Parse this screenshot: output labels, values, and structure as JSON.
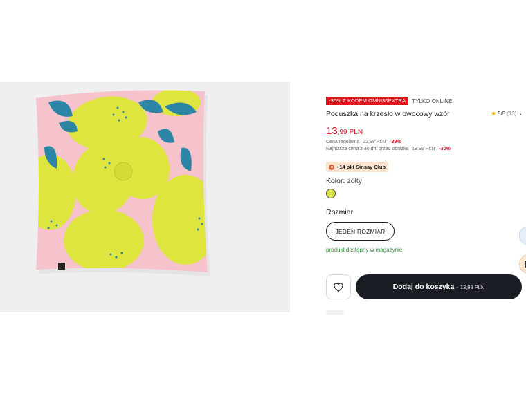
{
  "product": {
    "promo_badge": "-30% Z KODEM OMNI30EXTRA",
    "online_badge": "TYLKO ONLINE",
    "title": "Poduszka na krzesło w owocowy wzór",
    "rating": {
      "score": "5/5",
      "count": "(13)"
    },
    "price": {
      "int": "13",
      "dec": ",99",
      "currency": "PLN",
      "regular_label": "Cena regularna",
      "regular_value": "22,99 PLN",
      "regular_discount": "-39%",
      "lowest_label": "Najniższa cena z 30 dni przed obniżką",
      "lowest_value": "19,99 PLN",
      "lowest_discount": "-30%"
    },
    "club": {
      "points": "+14 pkt",
      "name": "Sinsay Club"
    },
    "color": {
      "label": "Kolor:",
      "value": "żółty",
      "swatch_hex": "#dbe24d"
    },
    "size": {
      "label": "Rozmiar",
      "option": "JEDEN ROZMIAR"
    },
    "availability": "produkt dostępny w magazynie",
    "cart": {
      "label": "Dodaj do koszyka",
      "separator": "-",
      "amount": "13,99 PLN"
    }
  },
  "colors": {
    "pillow_pink": "#f6c3cd",
    "lemon_yellow": "#dee53f",
    "leaf_blue": "#2e86a6",
    "price_red": "#d4182a",
    "cart_button": "#1b1d24",
    "availability_green": "#2f8f3a"
  },
  "icons": {
    "wishlist": "heart-icon",
    "rating": "star-icon",
    "rating_more": "chevron-right-icon",
    "club": "club-points-icon"
  }
}
